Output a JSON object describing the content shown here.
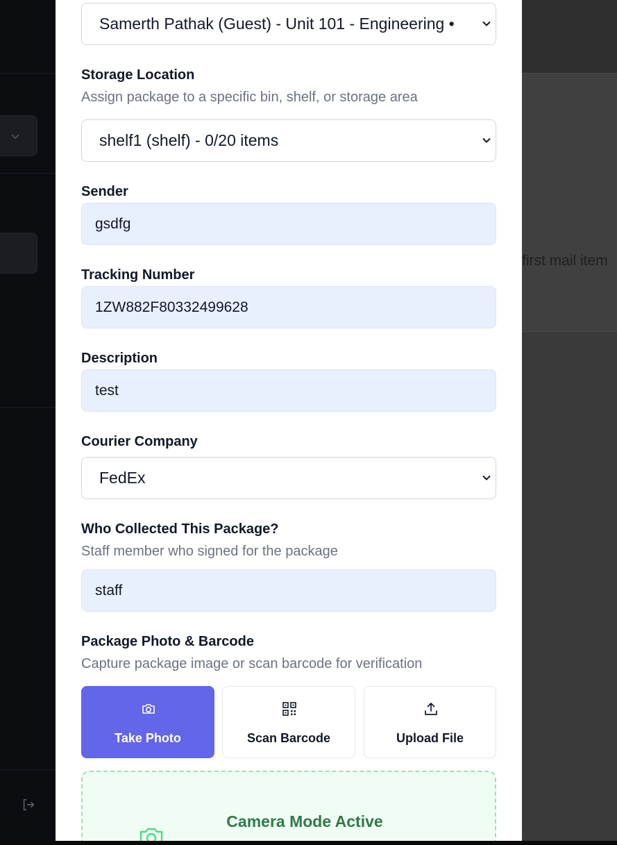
{
  "background": {
    "right_snippet": "first mail item"
  },
  "form": {
    "recipient_select": {
      "value": "Samerth Pathak (Guest) - Unit 101 - Engineering •"
    },
    "storage": {
      "label": "Storage Location",
      "hint": "Assign package to a specific bin, shelf, or storage area",
      "value": "shelf1 (shelf) - 0/20 items"
    },
    "sender": {
      "label": "Sender",
      "value": "gsdfg"
    },
    "tracking": {
      "label": "Tracking Number",
      "value": "1ZW882F80332499628"
    },
    "description": {
      "label": "Description",
      "value": "test"
    },
    "courier": {
      "label": "Courier Company",
      "value": "FedEx"
    },
    "collector": {
      "label": "Who Collected This Package?",
      "hint": "Staff member who signed for the package",
      "value": "staff"
    },
    "photo": {
      "label": "Package Photo & Barcode",
      "hint": "Capture package image or scan barcode for verification",
      "tiles": [
        {
          "label": "Take Photo",
          "icon": "camera-icon",
          "active": true
        },
        {
          "label": "Scan Barcode",
          "icon": "qr-code-icon",
          "active": false
        },
        {
          "label": "Upload File",
          "icon": "upload-icon",
          "active": false
        }
      ],
      "camera_status": "Camera Mode Active"
    }
  },
  "colors": {
    "accent": "#6366e8",
    "input_fill": "#e8effd",
    "camera_green": "#2f7a47",
    "camera_bg": "#f0fdf4"
  }
}
